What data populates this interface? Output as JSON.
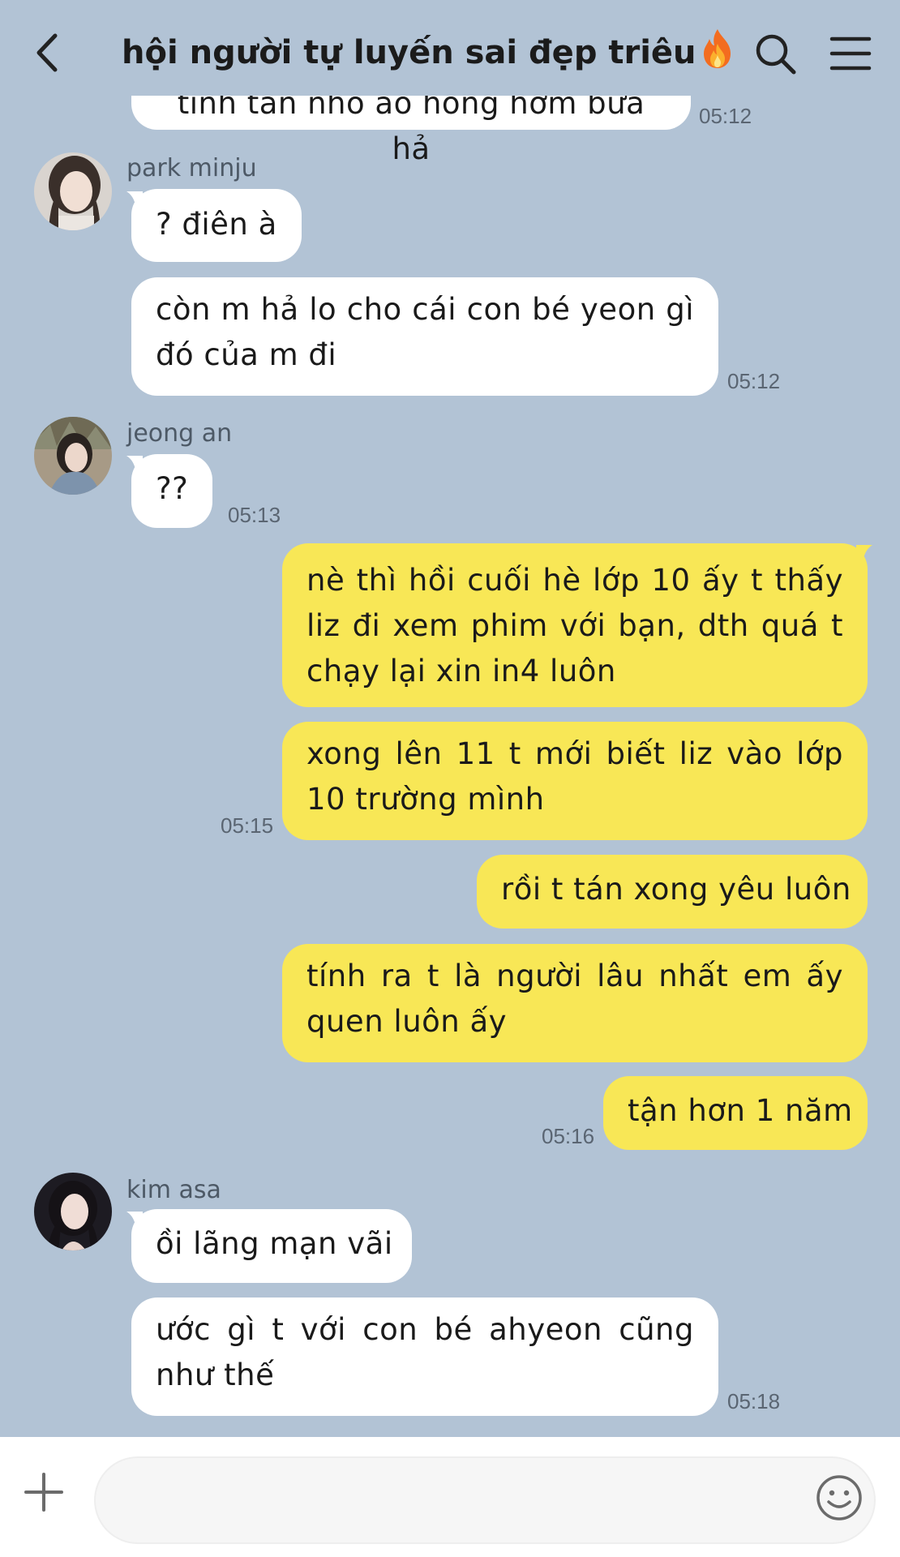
{
  "header": {
    "title": "hội người tự luyến sai đẹp triêu",
    "title_icon": "fire-emoji",
    "back_icon": "chevron-left-icon",
    "search_icon": "search-icon",
    "menu_icon": "hamburger-menu-icon"
  },
  "messages": [
    {
      "direction": "in",
      "text": "tính tán nhỏ áo hồng hơm bữa hả",
      "time": "05:12"
    },
    {
      "direction": "in",
      "sender": "park minju",
      "text": "? điên à"
    },
    {
      "direction": "in",
      "text": "còn m hả lo cho cái con bé yeon gì đó của m đi",
      "time": "05:12"
    },
    {
      "direction": "in",
      "sender": "jeong an",
      "text": "??",
      "time": "05:13"
    },
    {
      "direction": "out",
      "text": "nè thì hồi cuối hè lớp 10 ấy t thấy liz đi xem phim với bạn, dth quá t chạy lại xin in4 luôn"
    },
    {
      "direction": "out",
      "text": "xong lên 11 t mới biết liz vào lớp 10 trường mình",
      "time": "05:15"
    },
    {
      "direction": "out",
      "text": "rồi t tán xong yêu luôn"
    },
    {
      "direction": "out",
      "text": "tính ra t là người lâu nhất em ấy quen luôn ấy"
    },
    {
      "direction": "out",
      "text": "tận hơn 1 năm",
      "time": "05:16"
    },
    {
      "direction": "in",
      "sender": "kim asa",
      "text": "ồi lãng mạn vãi"
    },
    {
      "direction": "in",
      "text": "ước gì t với con bé ahyeon cũng như thế",
      "time": "05:18"
    }
  ],
  "composer": {
    "input_value": "",
    "plus_icon": "plus-icon",
    "emoji_icon": "smiley-icon"
  },
  "colors": {
    "background": "#b2c3d5",
    "incoming_bubble": "#ffffff",
    "outgoing_bubble": "#f8e756"
  }
}
